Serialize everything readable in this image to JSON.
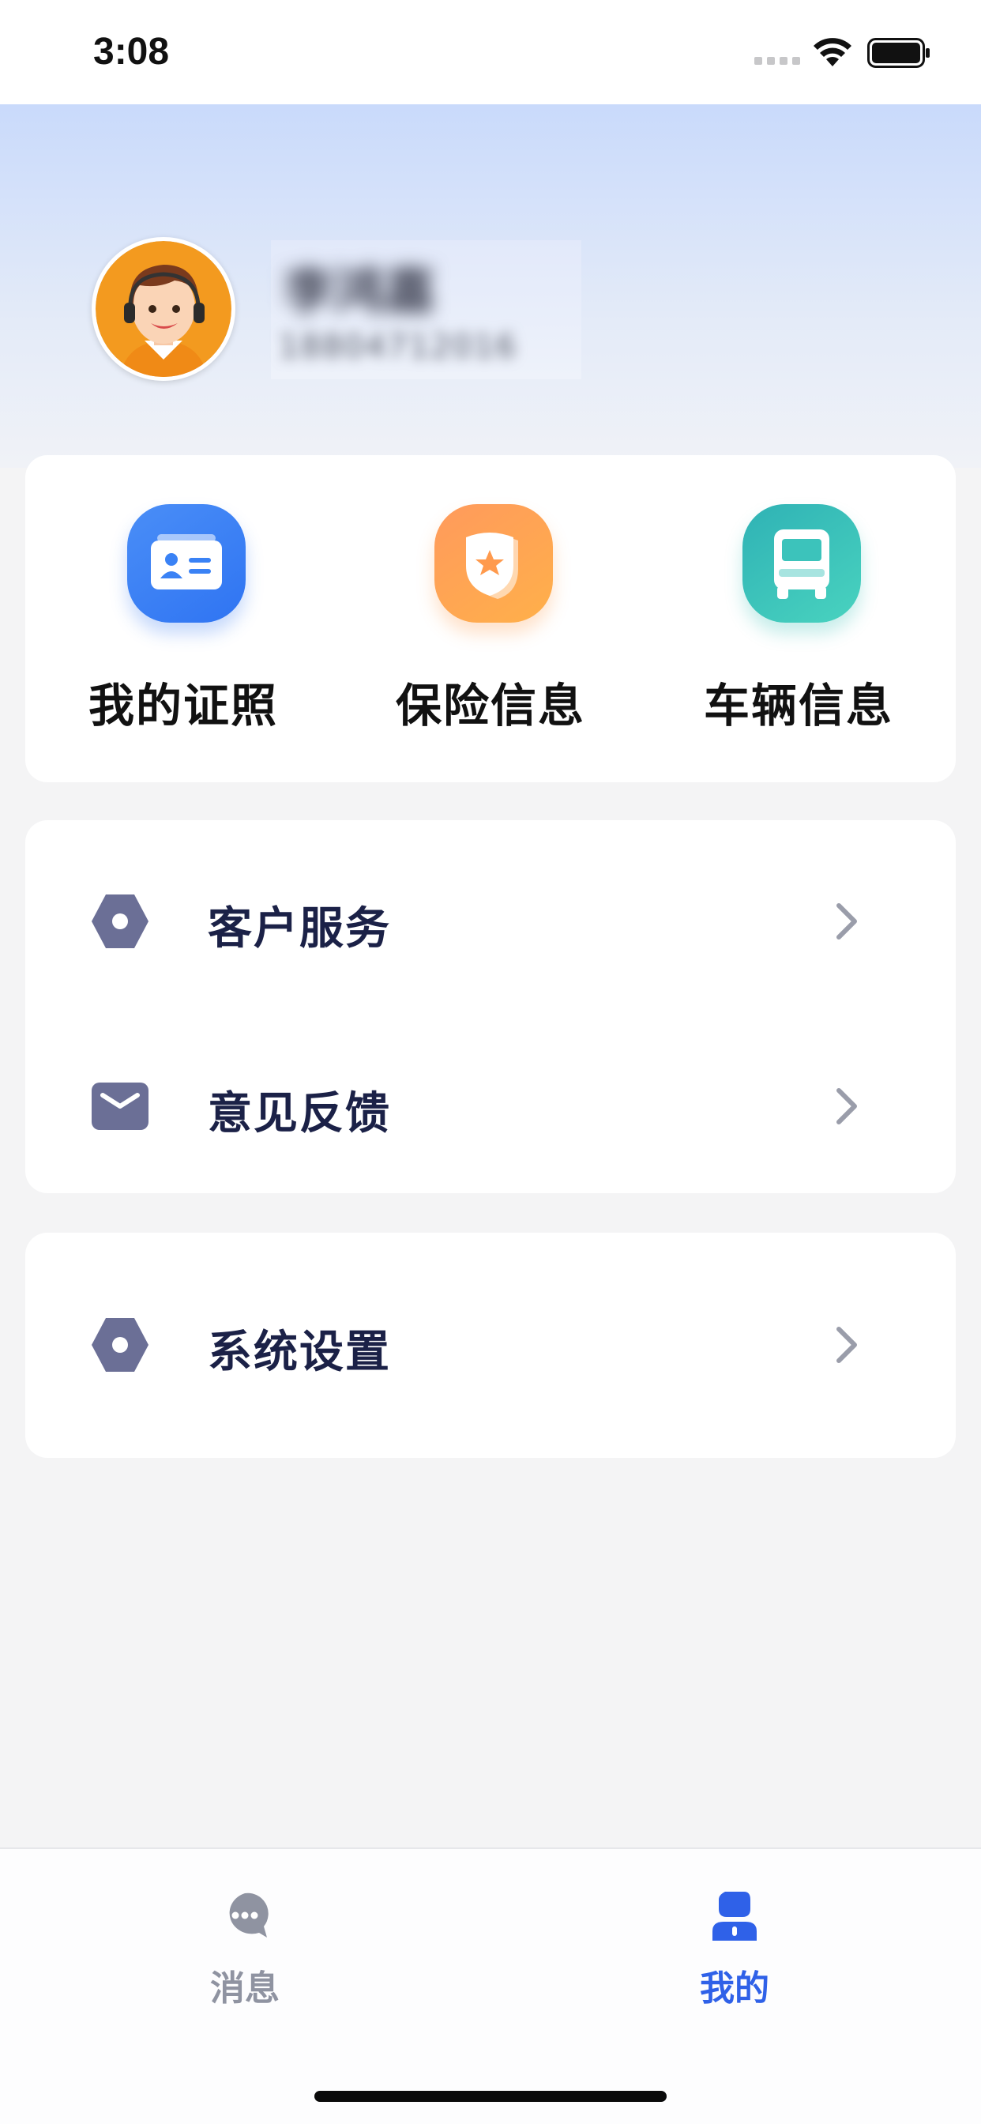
{
  "status_bar": {
    "time": "3:08"
  },
  "profile": {
    "name": "李鸿嘉",
    "phone": "18804712016",
    "avatar_icon": "customer-service-avatar"
  },
  "quick_actions": [
    {
      "label": "我的证照",
      "icon": "id-card-icon",
      "color": "#3a82f5"
    },
    {
      "label": "保险信息",
      "icon": "shield-star-icon",
      "color": "#ff9f55"
    },
    {
      "label": "车辆信息",
      "icon": "truck-icon",
      "color": "#3cc3bb"
    }
  ],
  "menu": {
    "service": {
      "label": "客户服务",
      "icon": "hexagon-icon"
    },
    "feedback": {
      "label": "意见反馈",
      "icon": "envelope-icon"
    },
    "settings": {
      "label": "系统设置",
      "icon": "hexagon-icon"
    }
  },
  "tabbar": {
    "messages": {
      "label": "消息",
      "icon": "chat-bubble-icon",
      "color": "#8f93a1"
    },
    "mine": {
      "label": "我的",
      "icon": "person-icon",
      "color": "#2f61e8",
      "active": true
    }
  }
}
